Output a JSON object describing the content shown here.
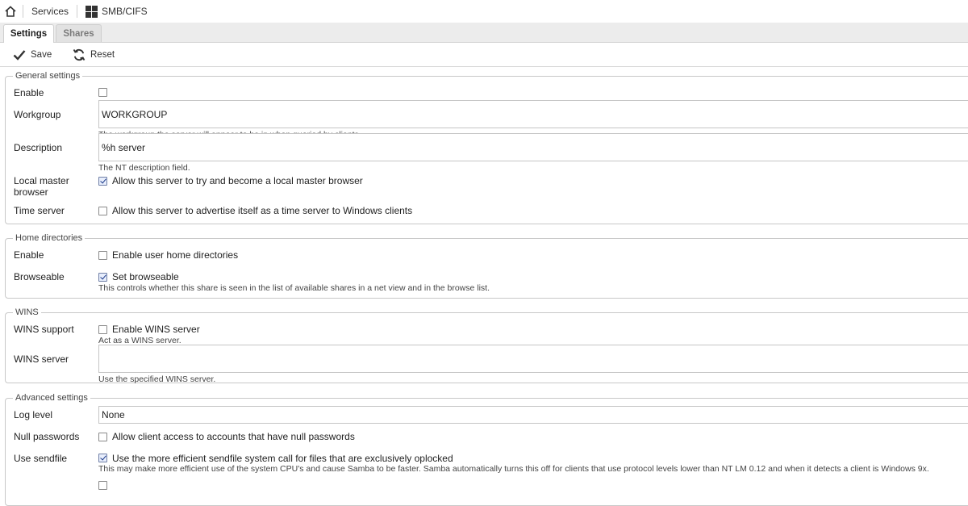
{
  "breadcrumb": {
    "items": [
      "Services",
      "SMB/CIFS"
    ]
  },
  "tabs": [
    {
      "label": "Settings",
      "active": true
    },
    {
      "label": "Shares",
      "active": false
    }
  ],
  "toolbar": {
    "save_label": "Save",
    "reset_label": "Reset"
  },
  "general": {
    "legend": "General settings",
    "enable_label": "Enable",
    "enable_checked": false,
    "workgroup_label": "Workgroup",
    "workgroup_value": "WORKGROUP",
    "workgroup_help": "The workgroup the server will appear to be in when queried by clients.",
    "description_label": "Description",
    "description_value": "%h server",
    "description_help": "The NT description field.",
    "localmaster_label_1": "Local master",
    "localmaster_label_2": "browser",
    "localmaster_checked": true,
    "localmaster_text": "Allow this server to try and become a local master browser",
    "timeserver_label": "Time server",
    "timeserver_checked": false,
    "timeserver_text": "Allow this server to advertise itself as a time server to Windows clients"
  },
  "home": {
    "legend": "Home directories",
    "enable_label": "Enable",
    "enable_checked": false,
    "enable_text": "Enable user home directories",
    "browseable_label": "Browseable",
    "browseable_checked": true,
    "browseable_text": "Set browseable",
    "browseable_help": "This controls whether this share is seen in the list of available shares in a net view and in the browse list."
  },
  "wins": {
    "legend": "WINS",
    "support_label": "WINS support",
    "support_checked": false,
    "support_text": "Enable WINS server",
    "support_help": "Act as a WINS server.",
    "server_label": "WINS server",
    "server_value": "",
    "server_help": "Use the specified WINS server."
  },
  "advanced": {
    "legend": "Advanced settings",
    "loglevel_label": "Log level",
    "loglevel_value": "None",
    "nullpw_label": "Null passwords",
    "nullpw_checked": false,
    "nullpw_text": "Allow client access to accounts that have null passwords",
    "sendfile_label": "Use sendfile",
    "sendfile_checked": true,
    "sendfile_text": "Use the more efficient sendfile system call for files that are exclusively oplocked",
    "sendfile_help": "This may make more efficient use of the system CPU's and cause Samba to be faster. Samba automatically turns this off for clients that use protocol levels lower than NT LM 0.12 and when it detects a client is Windows 9x."
  }
}
